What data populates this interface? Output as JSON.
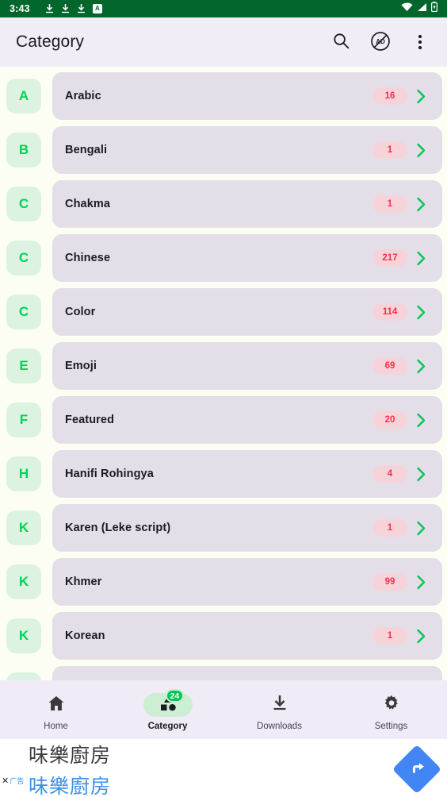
{
  "status_bar": {
    "time": "3:43",
    "download_icons": [
      "download-icon",
      "download-icon",
      "download-icon"
    ],
    "app_badge": "A",
    "wifi": "wifi-icon",
    "signal": "signal-icon",
    "battery": "battery-icon"
  },
  "appbar": {
    "title": "Category",
    "actions": [
      {
        "name": "search-icon",
        "label": "Search"
      },
      {
        "name": "ad-block-icon",
        "label": "AD"
      },
      {
        "name": "overflow-menu-icon",
        "label": "More options"
      }
    ]
  },
  "categories": [
    {
      "letter": "A",
      "name": "Arabic",
      "count": "16"
    },
    {
      "letter": "B",
      "name": "Bengali",
      "count": "1"
    },
    {
      "letter": "C",
      "name": "Chakma",
      "count": "1"
    },
    {
      "letter": "C",
      "name": "Chinese",
      "count": "217"
    },
    {
      "letter": "C",
      "name": "Color",
      "count": "114"
    },
    {
      "letter": "E",
      "name": "Emoji",
      "count": "69"
    },
    {
      "letter": "F",
      "name": "Featured",
      "count": "20"
    },
    {
      "letter": "H",
      "name": "Hanifi Rohingya",
      "count": "4"
    },
    {
      "letter": "K",
      "name": "Karen (Leke script)",
      "count": "1"
    },
    {
      "letter": "K",
      "name": "Khmer",
      "count": "99"
    },
    {
      "letter": "K",
      "name": "Korean",
      "count": "1"
    },
    {
      "letter": "",
      "name": "",
      "count": ""
    }
  ],
  "bottom_nav": {
    "items": [
      {
        "label": "Home",
        "icon": "home-icon",
        "active": false,
        "badge": ""
      },
      {
        "label": "Category",
        "icon": "category-icon",
        "active": true,
        "badge": "24"
      },
      {
        "label": "Downloads",
        "icon": "download-icon",
        "active": false,
        "badge": ""
      },
      {
        "label": "Settings",
        "icon": "gear-icon",
        "active": false,
        "badge": ""
      }
    ]
  },
  "ad": {
    "headline": "味樂廚房",
    "subline": "味樂廚房",
    "close_label": "广告",
    "close_mark": "✕",
    "cta_icon": "turn-right-arrow-icon"
  },
  "colors": {
    "status_bar_bg": "#00662B",
    "appbar_bg": "#F1EDF6",
    "page_bg": "#FCFEF4",
    "card_bg": "#E4DEE9",
    "tile_bg": "#DCF3E2",
    "tile_text": "#00D355",
    "badge_bg": "#F6D3D9",
    "badge_text": "#F4304A",
    "chevron": "#00C853",
    "nav_bg": "#F1EBF7",
    "nav_active_pill": "#CCEED3",
    "nav_badge": "#00C853",
    "ad_blue": "#4285F4"
  }
}
